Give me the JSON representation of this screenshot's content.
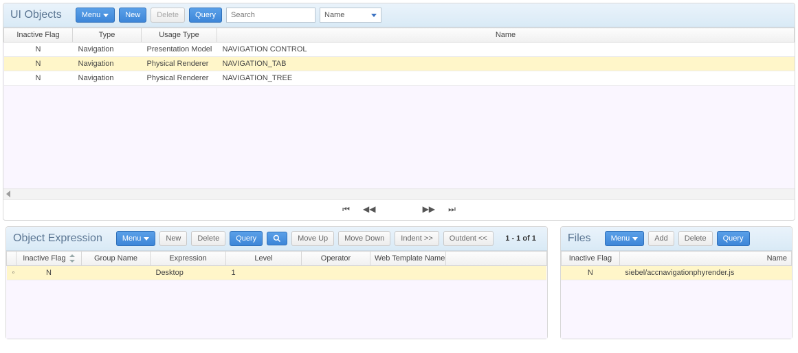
{
  "uiObjects": {
    "title": "UI Objects",
    "menuLabel": "Menu",
    "newLabel": "New",
    "deleteLabel": "Delete",
    "queryLabel": "Query",
    "searchPlaceholder": "Search",
    "searchField": "Name",
    "columns": {
      "inactiveFlag": "Inactive Flag",
      "type": "Type",
      "usageType": "Usage Type",
      "name": "Name"
    },
    "rows": [
      {
        "inactive": "N",
        "type": "Navigation",
        "usage": "Presentation Model",
        "name": "NAVIGATION CONTROL"
      },
      {
        "inactive": "N",
        "type": "Navigation",
        "usage": "Physical Renderer",
        "name": "NAVIGATION_TAB"
      },
      {
        "inactive": "N",
        "type": "Navigation",
        "usage": "Physical Renderer",
        "name": "NAVIGATION_TREE"
      }
    ]
  },
  "objectExpression": {
    "title": "Object Expression",
    "menuLabel": "Menu",
    "newLabel": "New",
    "deleteLabel": "Delete",
    "queryLabel": "Query",
    "moveUpLabel": "Move Up",
    "moveDownLabel": "Move Down",
    "indentLabel": "Indent >>",
    "outdentLabel": "Outdent <<",
    "recordInfo": "1 - 1 of 1",
    "columns": {
      "inactiveFlag": "Inactive Flag",
      "groupName": "Group Name",
      "expression": "Expression",
      "level": "Level",
      "operator": "Operator",
      "webTemplate": "Web Template Name"
    },
    "rows": [
      {
        "inactive": "N",
        "group": "",
        "expression": "Desktop",
        "level": "1",
        "operator": "",
        "webTemplate": ""
      }
    ]
  },
  "files": {
    "title": "Files",
    "menuLabel": "Menu",
    "addLabel": "Add",
    "deleteLabel": "Delete",
    "queryLabel": "Query",
    "columns": {
      "inactiveFlag": "Inactive Flag",
      "name": "Name"
    },
    "rows": [
      {
        "inactive": "N",
        "name": "siebel/accnavigationphyrender.js"
      }
    ]
  }
}
